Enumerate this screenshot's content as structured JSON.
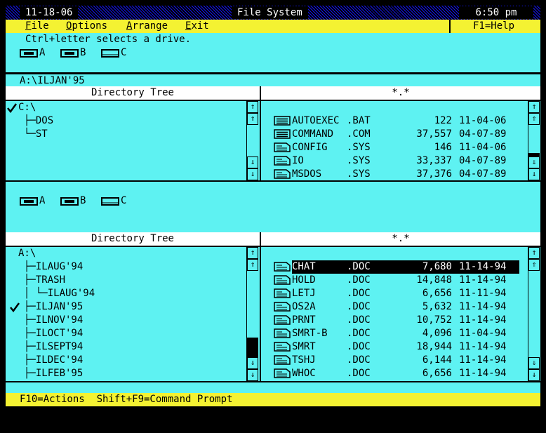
{
  "titlebar": {
    "date": "11-18-06",
    "title": "File System",
    "time": "6:50 pm"
  },
  "menu": {
    "file": "File",
    "options": "Options",
    "arrange": "Arrange",
    "exit": "Exit",
    "help": "F1=Help"
  },
  "hint": "Ctrl+letter selects a drive.",
  "drives": [
    "A",
    "B",
    "C"
  ],
  "path": "A:\\ILJAN'95",
  "top": {
    "tree_header": "Directory Tree",
    "files_header": "*.*",
    "root": "C:\\",
    "tree": [
      "├─DOS",
      "└─ST"
    ],
    "files": [
      {
        "name": "AUTOEXEC",
        "ext": ".BAT",
        "size": "122",
        "date": "11-04-06",
        "icon": "exec-file-icon"
      },
      {
        "name": "COMMAND",
        "ext": ".COM",
        "size": "37,557",
        "date": "04-07-89",
        "icon": "exec-file-icon"
      },
      {
        "name": "CONFIG",
        "ext": ".SYS",
        "size": "146",
        "date": "11-04-06",
        "icon": "file-icon"
      },
      {
        "name": "IO",
        "ext": ".SYS",
        "size": "33,337",
        "date": "04-07-89",
        "icon": "file-icon"
      },
      {
        "name": "MSDOS",
        "ext": ".SYS",
        "size": "37,376",
        "date": "04-07-89",
        "icon": "file-icon"
      }
    ]
  },
  "bottom": {
    "tree_header": "Directory Tree",
    "files_header": "*.*",
    "root": "A:\\",
    "tree": [
      "├─ILAUG'94",
      "├─TRASH",
      "│ └─ILAUG'94",
      "├─ILJAN'95",
      "├─ILNOV'94",
      "├─ILOCT'94",
      "├─ILSEPT94",
      "├─ILDEC'94",
      "├─ILFEB'95"
    ],
    "files": [
      {
        "name": "CHAT",
        "ext": ".DOC",
        "size": "7,680",
        "date": "11-14-94"
      },
      {
        "name": "HOLD",
        "ext": ".DOC",
        "size": "14,848",
        "date": "11-14-94"
      },
      {
        "name": "LETJ",
        "ext": ".DOC",
        "size": "6,656",
        "date": "11-11-94"
      },
      {
        "name": "OS2A",
        "ext": ".DOC",
        "size": "5,632",
        "date": "11-14-94"
      },
      {
        "name": "PRNT",
        "ext": ".DOC",
        "size": "10,752",
        "date": "11-14-94"
      },
      {
        "name": "SMRT-B",
        "ext": ".DOC",
        "size": "4,096",
        "date": "11-04-94"
      },
      {
        "name": "SMRT",
        "ext": ".DOC",
        "size": "18,944",
        "date": "11-14-94"
      },
      {
        "name": "TSHJ",
        "ext": ".DOC",
        "size": "6,144",
        "date": "11-14-94"
      },
      {
        "name": "WHOC",
        "ext": ".DOC",
        "size": "6,656",
        "date": "11-14-94"
      }
    ]
  },
  "status": "F10=Actions  Shift+F9=Command Prompt",
  "colors": {
    "background": "#5ef2f2",
    "menubar": "#f4f232",
    "titlebar": "#1414ee"
  }
}
